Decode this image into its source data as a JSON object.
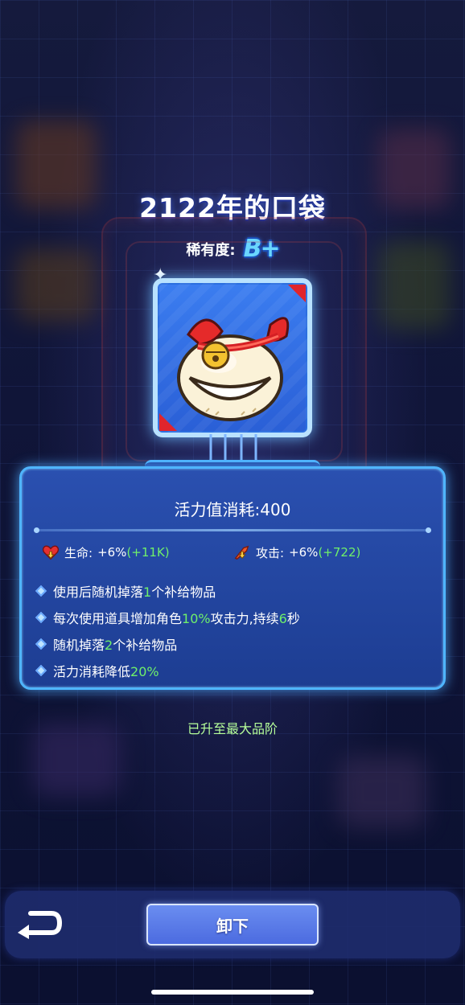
{
  "item": {
    "title": "2122年的口袋",
    "rarity_label": "稀有度:",
    "rarity_value": "B+",
    "icon": "bell-pouch-icon"
  },
  "panel": {
    "energy_cost": "活力值消耗:400",
    "stats": [
      {
        "icon": "heart-up-icon",
        "label": "生命:",
        "value": "+6%",
        "bonus": "(+11K)"
      },
      {
        "icon": "attack-up-icon",
        "label": "攻击:",
        "value": "+6%",
        "bonus": "(+722)"
      }
    ],
    "effects": [
      {
        "pre": "使用后随机掉落",
        "hl": "1",
        "post": "个补给物品"
      },
      {
        "pre": "每次使用道具增加角色",
        "hl": "10%",
        "mid": "攻击力,持续",
        "hl2": "6",
        "post": "秒"
      },
      {
        "pre": "随机掉落",
        "hl": "2",
        "post": "个补给物品"
      },
      {
        "pre": "活力消耗降低",
        "hl": "20%",
        "post": ""
      }
    ]
  },
  "max_grade_text": "已升至最大品阶",
  "footer": {
    "back_icon": "back-arrow-icon",
    "unequip_label": "卸下"
  },
  "colors": {
    "highlight_green": "#6ff06a",
    "panel_border": "#4fb5ff",
    "rarity_blue": "#6ad6ff",
    "accent_red": "#e0252c"
  }
}
